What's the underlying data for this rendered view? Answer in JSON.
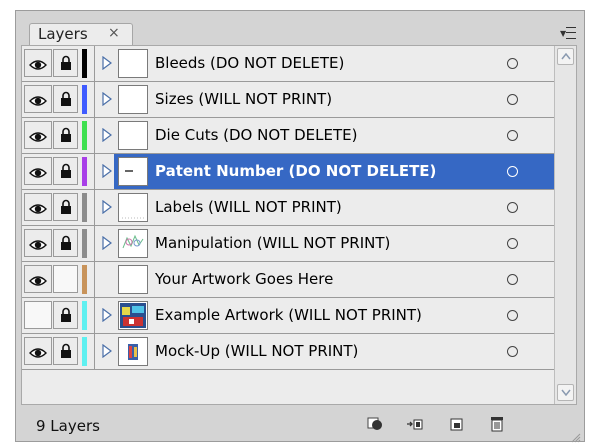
{
  "panel": {
    "tab_label": "Layers",
    "tab_close": "×",
    "footer_count": "9 Layers"
  },
  "layers": [
    {
      "name": "Bleeds (DO NOT DELETE)",
      "visible": true,
      "locked": true,
      "color": "#000000",
      "expandable": true,
      "thumb": "blank",
      "selected": false
    },
    {
      "name": "Sizes (WILL NOT PRINT)",
      "visible": true,
      "locked": true,
      "color": "#3f5bff",
      "expandable": true,
      "thumb": "blank",
      "selected": false
    },
    {
      "name": "Die Cuts (DO NOT DELETE)",
      "visible": true,
      "locked": true,
      "color": "#3fe04f",
      "expandable": true,
      "thumb": "blank",
      "selected": false
    },
    {
      "name": "Patent Number (DO NOT DELETE)",
      "visible": true,
      "locked": true,
      "color": "#a83fe8",
      "expandable": true,
      "thumb": "line",
      "selected": true
    },
    {
      "name": "Labels (WILL NOT PRINT)",
      "visible": true,
      "locked": true,
      "color": "#8c8c8c",
      "expandable": true,
      "thumb": "dots",
      "selected": false
    },
    {
      "name": "Manipulation (WILL NOT PRINT)",
      "visible": true,
      "locked": true,
      "color": "#8c8c8c",
      "expandable": true,
      "thumb": "sketch",
      "selected": false
    },
    {
      "name": "Your Artwork Goes Here",
      "visible": true,
      "locked": false,
      "color": "#c8935a",
      "expandable": false,
      "thumb": "blank",
      "selected": false
    },
    {
      "name": "Example Artwork (WILL NOT PRINT)",
      "visible": false,
      "locked": true,
      "color": "#5ef0f0",
      "expandable": true,
      "thumb": "art",
      "selected": false
    },
    {
      "name": "Mock-Up (WILL NOT PRINT)",
      "visible": true,
      "locked": true,
      "color": "#5ef0f0",
      "expandable": true,
      "thumb": "mock",
      "selected": false
    }
  ],
  "footer_buttons": [
    "make-clipping-mask-icon",
    "create-sublayer-icon",
    "create-new-layer-icon",
    "delete-layer-icon"
  ]
}
